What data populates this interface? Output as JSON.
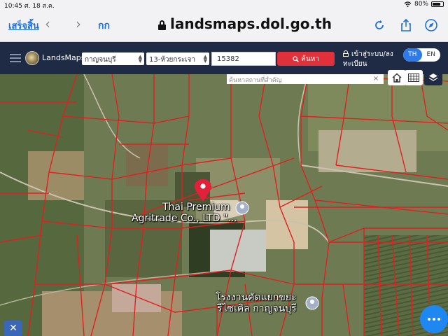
{
  "status_bar": {
    "time": "10:45",
    "date": "ศ. 18 ส.ค.",
    "wifi_icon": "wifi-icon",
    "battery_percent": "80%",
    "battery_level": 0.8
  },
  "browser": {
    "done_label": "เสร็จสิ้น",
    "text_size_label": "กก",
    "url": "landsmaps.dol.go.th",
    "icons": [
      "back-icon",
      "forward-icon",
      "lock-icon",
      "reload-icon",
      "share-icon",
      "compass-icon"
    ]
  },
  "header": {
    "brand": "LandsMaps",
    "province": "กาญจนบุรี",
    "district": "13-ห้วยกระเจา",
    "parcel_number": "15382",
    "search_label": "ค้นหา",
    "login_label": "เข้าสู่ระบบ/ลงทะเบียน",
    "lang_th": "TH",
    "lang_en": "EN",
    "active_lang": "TH"
  },
  "map": {
    "place_search_placeholder": "ค้นหาสถานที่สำคัญ",
    "clear_symbol": "×",
    "places": {
      "factory_line1": "Thai Premium",
      "factory_line2": "Agritrade Co., LTD \"...",
      "plant_line1": "โรงงานคัดแยกขยะ",
      "plant_line2": "รีไซเคิล กาญจนบุรี"
    },
    "colors": {
      "parcel_lines": "#e02020",
      "marker": "#e3203a",
      "header_bg": "#1f2a44",
      "search_button": "#e0303a",
      "accent_blue": "#1e88f0"
    },
    "controls": [
      "home-icon",
      "grid-icon",
      "layers-icon",
      "more-icon",
      "tools-icon"
    ]
  }
}
